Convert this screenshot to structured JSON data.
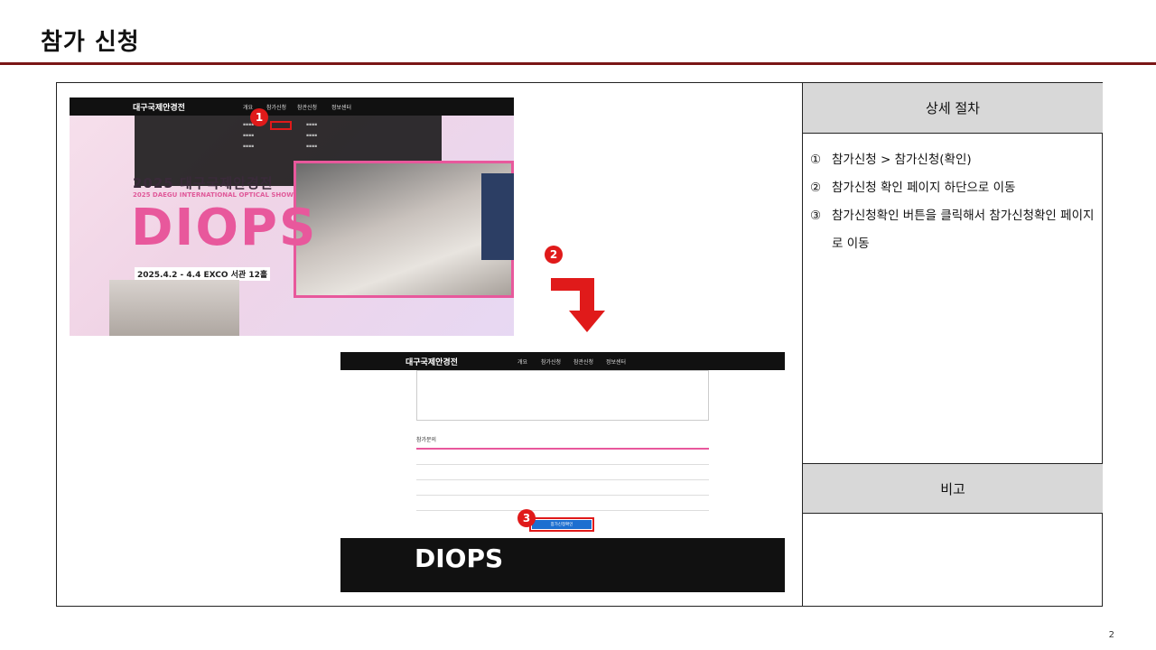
{
  "title": "참가 신청",
  "side": {
    "header": "상세 절차",
    "steps": [
      {
        "num": "①",
        "text": "참가신청 > 참가신청(확인)"
      },
      {
        "num": "②",
        "text": "참가신청 확인 페이지 하단으로 이동"
      },
      {
        "num": "③",
        "text": "참가신청확인 버튼을 클릭해서 참가신청확인 페이지로 이동"
      }
    ],
    "note_header": "비고"
  },
  "shot1": {
    "logo": "대구국제안경전",
    "menu": [
      "개요",
      "참가신청",
      "참관신청",
      "정보센터"
    ],
    "year_title": "2025 대구국제안경전",
    "subtitle": "2025 DAEGU INTERNATIONAL OPTICAL SHOW",
    "brand": "DIOPS",
    "date": "2025.4.2 - 4.4 EXCO 서관 12홀"
  },
  "shot2": {
    "logo": "대구국제안경전",
    "menu": [
      "개요",
      "참가신청",
      "참관신청",
      "정보센터"
    ],
    "section": "참가문의",
    "button": "참가신청확인",
    "brand": "DIOPS"
  },
  "badges": [
    "1",
    "2",
    "3"
  ],
  "page_number": "2",
  "colors": {
    "accent": "#7a1515",
    "marker": "#e01a1a",
    "brand_pink": "#e8589c"
  }
}
